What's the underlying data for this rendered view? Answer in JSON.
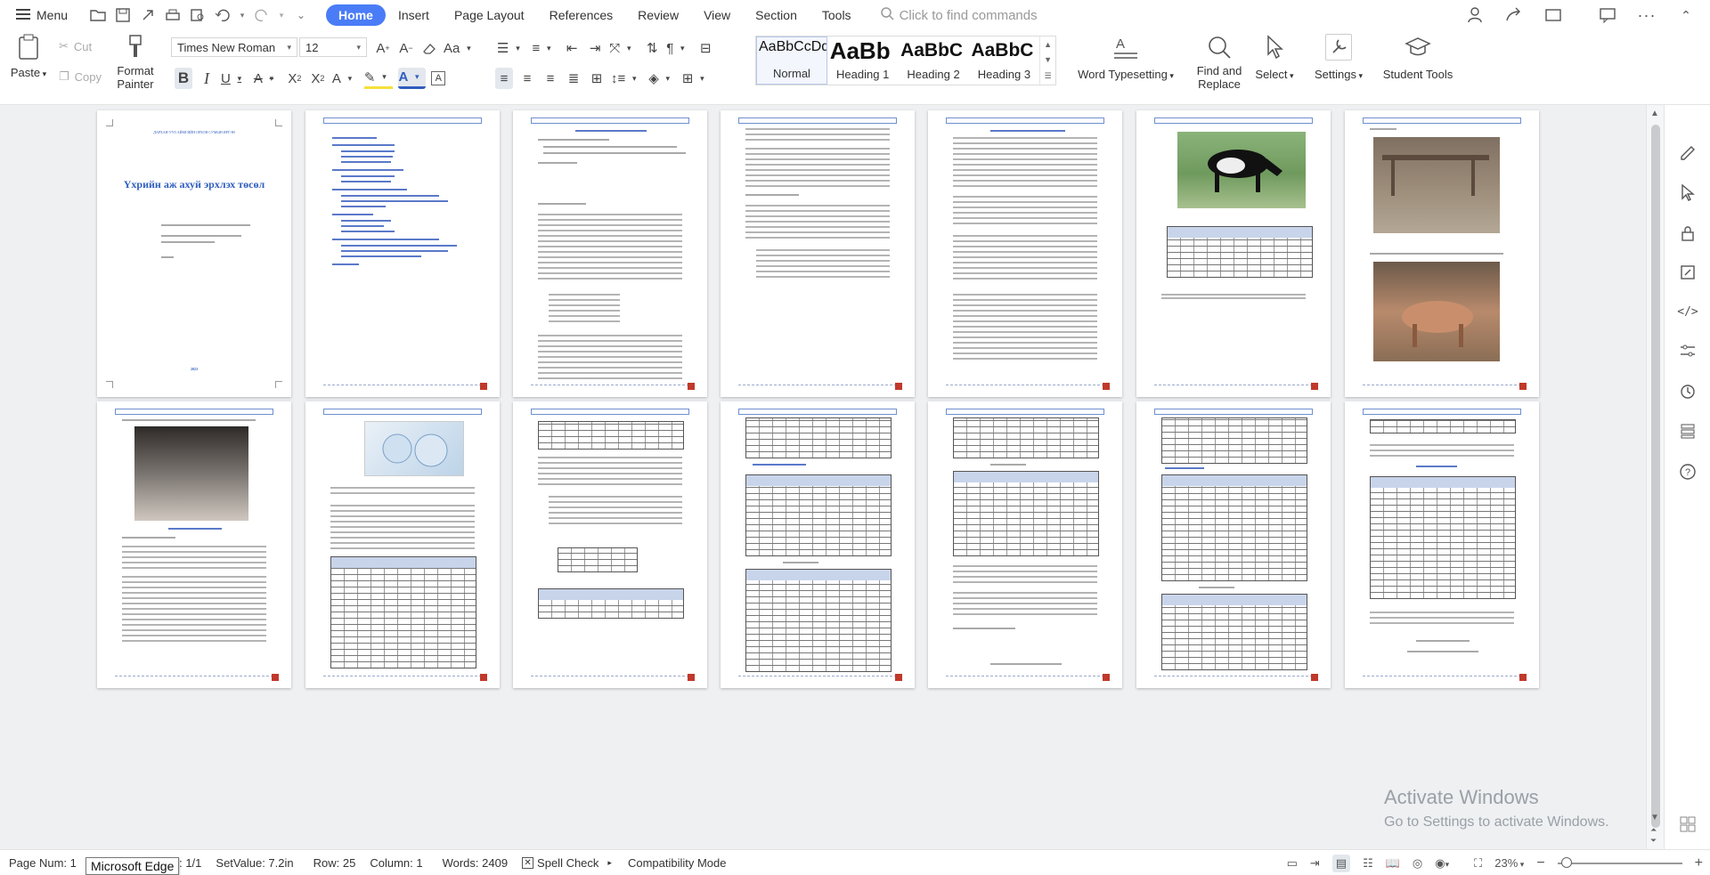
{
  "menubar": {
    "menu_label": "Menu",
    "tabs": [
      {
        "label": "Home",
        "active": true
      },
      {
        "label": "Insert"
      },
      {
        "label": "Page Layout"
      },
      {
        "label": "References"
      },
      {
        "label": "Review"
      },
      {
        "label": "View"
      },
      {
        "label": "Section"
      },
      {
        "label": "Tools"
      }
    ],
    "search_placeholder": "Click to find commands"
  },
  "ribbon": {
    "paste_label": "Paste",
    "cut_label": "Cut",
    "copy_label": "Copy",
    "format_painter_label": "Format Painter",
    "font_name": "Times New Roman",
    "font_size": "12",
    "styles": [
      {
        "preview": "AaBbCcDd",
        "name": "Normal",
        "selected": true
      },
      {
        "preview": "AaBb",
        "name": "Heading 1"
      },
      {
        "preview": "AaBbC",
        "name": "Heading 2"
      },
      {
        "preview": "AaBbC",
        "name": "Heading 3"
      }
    ],
    "word_typesetting_label": "Word Typesetting",
    "find_replace_label": "Find and Replace",
    "select_label": "Select",
    "settings_label": "Settings",
    "student_tools_label": "Student Tools",
    "accent_color": "#4a7cf7"
  },
  "document": {
    "cover_title": "Үхрийн аж ахуй эрхлэх төсөл",
    "cover_subtitle": "ДАРХАН-УУЛ АЙМГИЙН ОРХОН СУМЫН ИРГЭН",
    "cover_year": "2023"
  },
  "watermark": {
    "title": "Activate Windows",
    "subtitle": "Go to Settings to activate Windows."
  },
  "statusbar": {
    "page_num": "Page Num: 1",
    "pages": "n: 1/1",
    "setvalue": "SetValue: 7.2in",
    "row": "Row: 25",
    "column": "Column: 1",
    "words": "Words: 2409",
    "spell_check": "Spell Check",
    "compat_mode": "Compatibility Mode",
    "zoom": "23%",
    "tooltip": "Microsoft Edge"
  }
}
